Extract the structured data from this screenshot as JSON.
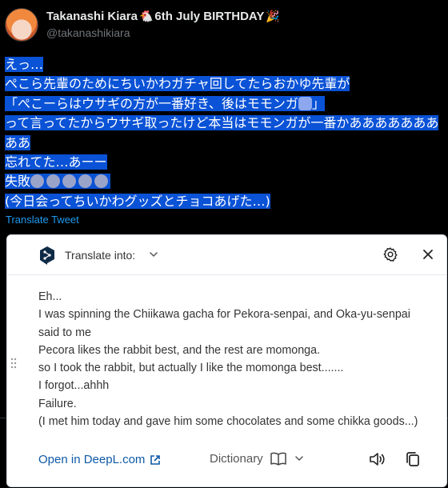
{
  "tweet": {
    "display_name": "Takanashi Kiara",
    "name_suffix": "6th July BIRTHDAY",
    "emoji_left": "🐔",
    "emoji_right": "🎉",
    "handle": "@takanashikiara",
    "lines": [
      "えっ…",
      "ぺこら先輩のためにちいかわガチャ回してたらおかゆ先輩が",
      "「ぺこーらはウサギの方が一番好き、後はモモンガ",
      "」",
      "って言ってたからウサギ取ったけど本当はモモンガが一番かあああああああ",
      "ああ",
      "忘れてた…あーー",
      "失敗",
      "(今日会ってちいかわグッズとチョコあげた…)"
    ],
    "translate_link": "Translate Tweet"
  },
  "popup": {
    "header_label": "Translate into:",
    "translation_lines": [
      "Eh...",
      "I was spinning the Chiikawa gacha for Pekora-senpai, and Oka-yu-senpai",
      "said to me",
      "Pecora likes the rabbit best, and the rest are momonga.",
      "so I took the rabbit, but actually I like the momonga best.......",
      "I forgot...ahhh",
      "Failure.",
      "(I met him today and gave him some chocolates and some chikka goods...)"
    ],
    "open_link": "Open in DeepL.com",
    "dictionary_label": "Dictionary"
  },
  "icons": {
    "logo": "deepl-logo-icon",
    "settings": "gear-icon",
    "close": "close-icon",
    "speaker": "speaker-icon",
    "copy": "copy-icon",
    "dictionary": "book-icon",
    "external": "external-link-icon"
  },
  "colors": {
    "highlight": "#0a52d6",
    "link": "#1d9bf0",
    "deepl_link": "#0f5aa7",
    "logo": "#0f2b46"
  }
}
